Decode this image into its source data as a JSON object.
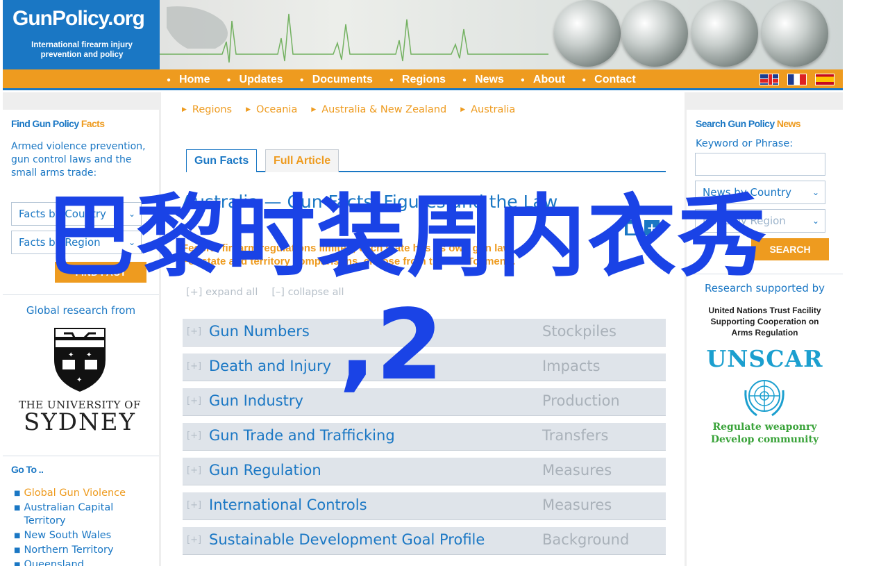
{
  "logo": {
    "title": "GunPolicy.org",
    "subtitle": "International firearm injury prevention and policy"
  },
  "nav": {
    "items": [
      "Home",
      "Updates",
      "Documents",
      "Regions",
      "News",
      "About",
      "Contact"
    ],
    "flags": [
      "flag-uk-icon",
      "flag-fr-icon",
      "flag-es-icon"
    ]
  },
  "left": {
    "find_heading_part1": "Find Gun Policy",
    "find_heading_part2": "Facts",
    "find_description": "Armed violence prevention, gun control laws and the small arms trade:",
    "select1": "Facts by Country",
    "select2": "Facts by Region",
    "find_button": "FIND FACT",
    "global_research": "Global research from",
    "sydney_line1": "THE UNIVERSITY OF",
    "sydney_line2": "SYDNEY",
    "goto_heading": "Go To ..",
    "goto_items": [
      "Global Gun Violence",
      "Australian Capital Territory",
      "New South Wales",
      "Northern Territory",
      "Queensland"
    ]
  },
  "main": {
    "breadcrumbs": [
      "Regions",
      "Oceania",
      "Australia & New Zealand",
      "Australia"
    ],
    "tabs": {
      "facts": "Gun Facts",
      "article": "Full Article"
    },
    "title": "Australia — Gun Facts, Figures and the Law",
    "intro_line1": "Federal firearm regulations limited; each state has its own gun law.",
    "intro_line2": "For state and territory comparisons, choose from the 'Go To' menu.",
    "expand_all": "expand all",
    "collapse_all": "collapse all",
    "expand_symbol": "[+]",
    "collapse_symbol": "[–]",
    "topics": [
      {
        "name": "Gun Numbers",
        "category": "Stockpiles"
      },
      {
        "name": "Death and Injury",
        "category": "Impacts"
      },
      {
        "name": "Gun Industry",
        "category": "Production"
      },
      {
        "name": "Gun Trade and Trafficking",
        "category": "Transfers"
      },
      {
        "name": "Gun Regulation",
        "category": "Measures"
      },
      {
        "name": "International Controls",
        "category": "Measures"
      },
      {
        "name": "Sustainable Development Goal Profile",
        "category": "Background"
      }
    ]
  },
  "right": {
    "news_heading_part1": "Search Gun Policy",
    "news_heading_part2": "News",
    "keyword_label": "Keyword or Phrase:",
    "keyword_value": "",
    "select1": "News by Country",
    "select2": "News by Region",
    "search_button": "SEARCH",
    "research_supported": "Research supported by",
    "unscar_text": "United Nations Trust Facility Supporting Cooperation on Arms Regulation",
    "unscar_logo": "UNSCAR",
    "unscar_tagline1": "Regulate weaponry",
    "unscar_tagline2": "Develop community"
  },
  "overlay": {
    "text": "巴黎时装周内衣秀",
    "suffix": ",2"
  }
}
